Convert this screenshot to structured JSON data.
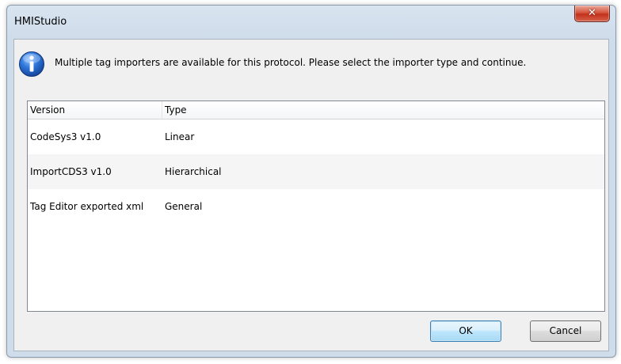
{
  "window": {
    "title": "HMIStudio",
    "close_glyph": "✕"
  },
  "message": {
    "icon": "info-icon",
    "text": "Multiple tag importers are available for this protocol. Please select the importer type and continue."
  },
  "importer_list": {
    "columns": [
      "Version",
      "Type"
    ],
    "rows": [
      {
        "version": "CodeSys3 v1.0",
        "type": "Linear"
      },
      {
        "version": "ImportCDS3 v1.0",
        "type": "Hierarchical"
      },
      {
        "version": "Tag Editor exported xml",
        "type": "General"
      }
    ]
  },
  "buttons": {
    "ok_label": "OK",
    "cancel_label": "Cancel"
  },
  "colors": {
    "title_bar": "#cfdcea",
    "close_button": "#c2321c",
    "info_icon": "#2a6ed1",
    "default_button_border": "#3c7fb1"
  }
}
